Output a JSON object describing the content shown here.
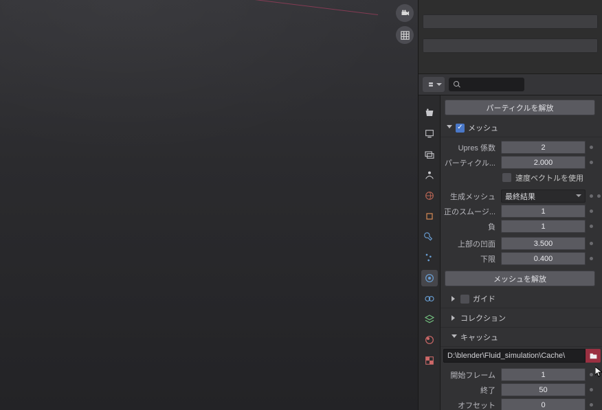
{
  "buttons": {
    "free_particles": "パーティクルを解放",
    "free_mesh": "メッシュを解放"
  },
  "sections": {
    "mesh": "メッシュ",
    "guide": "ガイド",
    "collection": "コレクション",
    "cache": "キャッシュ"
  },
  "labels": {
    "upres": "Upres 係数",
    "particle": "パーティクル...",
    "velocity_vectors": "速度ベクトルを使用",
    "gen_mesh": "生成メッシュ",
    "pos_smoothing": "正のスムージ...",
    "neg": "負",
    "top_concave": "上部の凹面",
    "lower": "下限",
    "start_frame": "開始フレーム",
    "end": "終了",
    "offset": "オフセット"
  },
  "values": {
    "upres": "2",
    "particle": "2.000",
    "gen_mesh": "最終結果",
    "pos_smoothing": "1",
    "neg": "1",
    "top_concave": "3.500",
    "lower": "0.400",
    "path": "D:\\blender\\Fluid_simulation\\Cache\\",
    "start_frame": "1",
    "end": "50",
    "offset": "0"
  }
}
